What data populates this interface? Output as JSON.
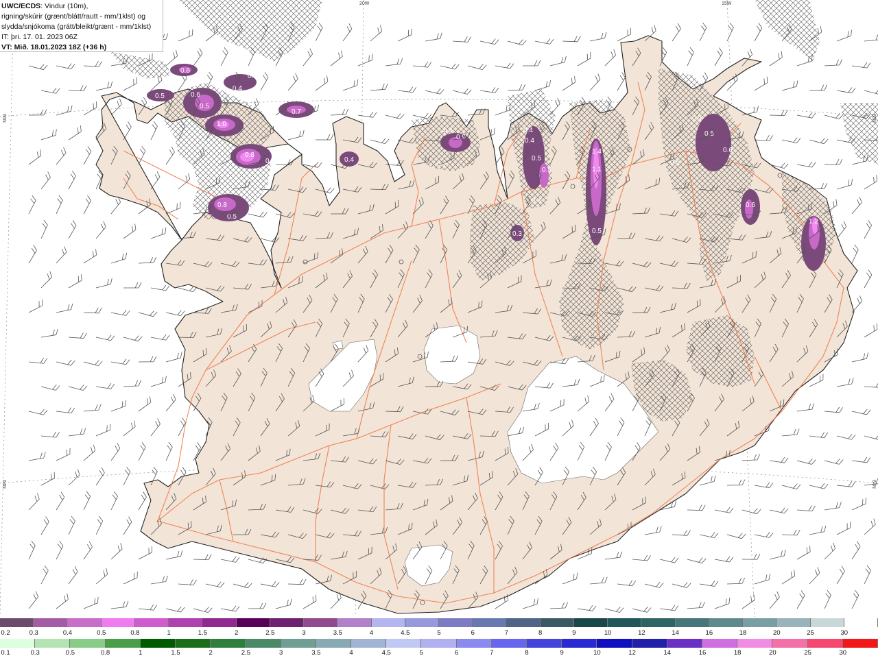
{
  "header": {
    "model": "UWC/ECDS",
    "line1_rest": ": Vindur (10m),",
    "line2": "rigning/skúrir (grænt/blátt/rautt - mm/1klst) og",
    "line3": "slydda/snjókoma (grátt/bleikt/grænt - mm/1klst)",
    "it_line": "IT: þri. 17. 01. 2023 06Z",
    "vt_line": "VT: Mið. 18.01.2023 18Z (+36 h)"
  },
  "axis_labels": {
    "top_20w": "20W",
    "top_15w": "15W",
    "left_66n": "66N",
    "left_64n": "64N",
    "right_66n": "66N",
    "right_64n": "64N"
  },
  "colors": {
    "land": "#f2e4d6",
    "sea": "#ffffff",
    "roads": "#f07a4a",
    "precip_light": "#cc66cc",
    "precip_mid": "#aa44aa",
    "precip_dark": "#774477",
    "hatch": "#555555"
  },
  "precip_labels": [
    "0.6",
    "0.3",
    "0.4",
    "0.5",
    "0.6",
    "0.5",
    "1.0",
    "0.7",
    "0.8",
    "0.7",
    "0.8",
    "0.5",
    "0.4",
    "0.4",
    "0.9",
    "0.2",
    "0.4",
    "0.4",
    "0.5",
    "0.4",
    "0.4",
    "1.4",
    "1.1",
    "0.5",
    "0.3",
    "0.3",
    "0.5",
    "0.6",
    "0.5",
    "0.6",
    "1.2"
  ],
  "legend": {
    "snow_labels": [
      "0.2",
      "0.3",
      "0.4",
      "0.5",
      "0.8",
      "1",
      "1.5",
      "2",
      "2.5",
      "3",
      "3.5",
      "4",
      "4.5",
      "5",
      "6",
      "7",
      "8",
      "9",
      "10",
      "12",
      "14",
      "16",
      "18",
      "20",
      "25",
      "30"
    ],
    "snow_colors": [
      "#6b4d6b",
      "#a45ca4",
      "#c86ec8",
      "#f07af0",
      "#d05ad0",
      "#b040b0",
      "#902890",
      "#580058",
      "#702070",
      "#904a90",
      "#b080c8",
      "#b4b4ee",
      "#9898dc",
      "#7c7cc4",
      "#6878b0",
      "#506488",
      "#3a5866",
      "#184848",
      "#20585a",
      "#2e6464",
      "#44767a",
      "#5e8a8e",
      "#7a9ea4",
      "#98b4ba",
      "#c8d8da",
      "#ffffff"
    ],
    "rain_labels": [
      "0.1",
      "0.3",
      "0.5",
      "0.8",
      "1",
      "1.5",
      "2",
      "2.5",
      "3",
      "3.5",
      "4",
      "4.5",
      "5",
      "6",
      "7",
      "8",
      "9",
      "10",
      "12",
      "14",
      "16",
      "18",
      "20",
      "25",
      "30"
    ],
    "rain_colors": [
      "#ddffdd",
      "#b4e4b4",
      "#88cc88",
      "#4a9e4a",
      "#005a00",
      "#1a6e1a",
      "#2e7e3e",
      "#4a8a66",
      "#6e9e94",
      "#88aab4",
      "#a0b4d4",
      "#c0c8f4",
      "#b0b0f0",
      "#8a8af0",
      "#6666ee",
      "#4444dd",
      "#2a2ad4",
      "#1010c0",
      "#2020a8",
      "#6a30c4",
      "#d070e0",
      "#f08ce4",
      "#f470a8",
      "#f44870",
      "#f01818"
    ]
  }
}
